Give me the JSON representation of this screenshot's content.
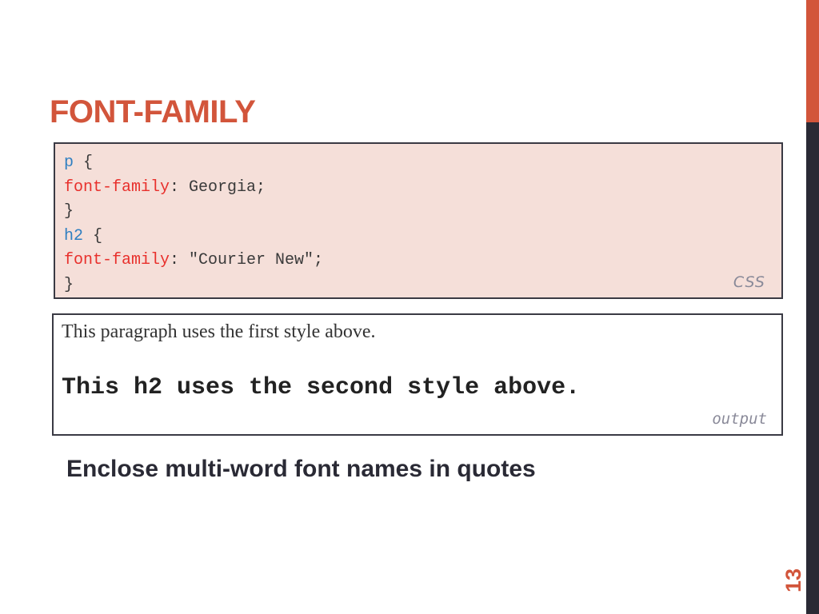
{
  "slide": {
    "title": "FONT-FAMILY",
    "page_number": "13",
    "accent_color": "#d2553b",
    "sidebar_dark_color": "#2a2a35"
  },
  "code": {
    "lines": [
      {
        "selector": "p",
        "rest": " {"
      },
      {
        "property": "font-family",
        "rest": ": Georgia;"
      },
      {
        "text": "}"
      },
      {
        "selector": "h2",
        "rest": " {"
      },
      {
        "property": "font-family",
        "rest": ": \"Courier New\";"
      },
      {
        "text": "}"
      }
    ],
    "label": "CSS"
  },
  "output": {
    "paragraph": "This paragraph uses the first style above.",
    "h2": "This h2 uses the second style above.",
    "label": "output"
  },
  "note": "Enclose multi-word font names in quotes"
}
